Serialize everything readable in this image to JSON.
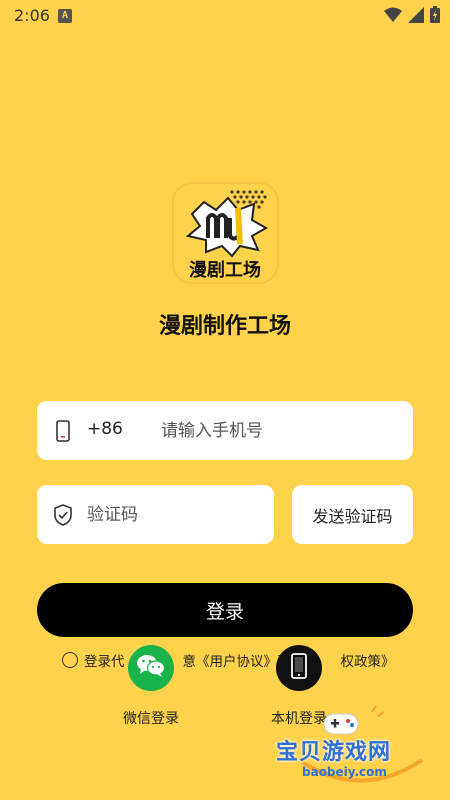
{
  "status_bar": {
    "time": "2:06",
    "notification_letter": "A",
    "icons": [
      "wifi-icon",
      "signal-icon",
      "battery-icon"
    ]
  },
  "app": {
    "logo_text": "漫剧工场",
    "name": "漫剧制作工场"
  },
  "form": {
    "country_code": "+86",
    "phone_placeholder": "请输入手机号",
    "code_placeholder": "验证码",
    "send_code_label": "发送验证码",
    "login_label": "登录"
  },
  "agreement": {
    "prefix": "登录代",
    "middle": "意《用户协议》和",
    "suffix": "权政策》"
  },
  "alt_login": {
    "wechat_label": "微信登录",
    "local_label": "本机登录"
  },
  "watermark": {
    "text": "宝贝游戏网",
    "url": "baobeiy.com"
  },
  "colors": {
    "background": "#FFD24C",
    "login_button": "#000000",
    "wechat": "#18B34A",
    "watermark": "#2F6FD6"
  }
}
